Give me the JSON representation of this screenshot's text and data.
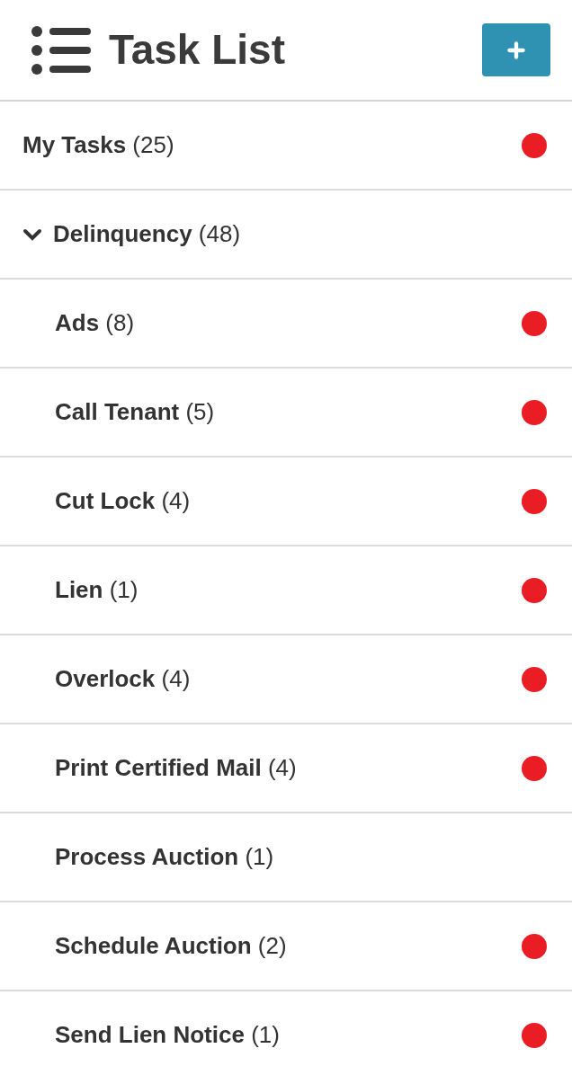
{
  "header": {
    "title": "Task List"
  },
  "items": [
    {
      "label": "**My Tasks** (25)",
      "alert": true
    },
    {
      "label": "**Delinquency** (48)",
      "alert": false,
      "expanded": true,
      "children": [
        {
          "label": "**Ads** (8)",
          "alert": true
        },
        {
          "label": "**Call Tenant** (5)",
          "alert": true
        },
        {
          "label": "**Cut Lock** (4)",
          "alert": true
        },
        {
          "label": "**Lien** (1)",
          "alert": true
        },
        {
          "label": "**Overlock** (4)",
          "alert": true
        },
        {
          "label": "**Print Certified Mail** (4)",
          "alert": true
        },
        {
          "label": "**Process Auction** (1)",
          "alert": false
        },
        {
          "label": "**Schedule Auction** (2)",
          "alert": true
        },
        {
          "label": "**Send Lien Notice** (1)",
          "alert": true
        }
      ]
    }
  ]
}
